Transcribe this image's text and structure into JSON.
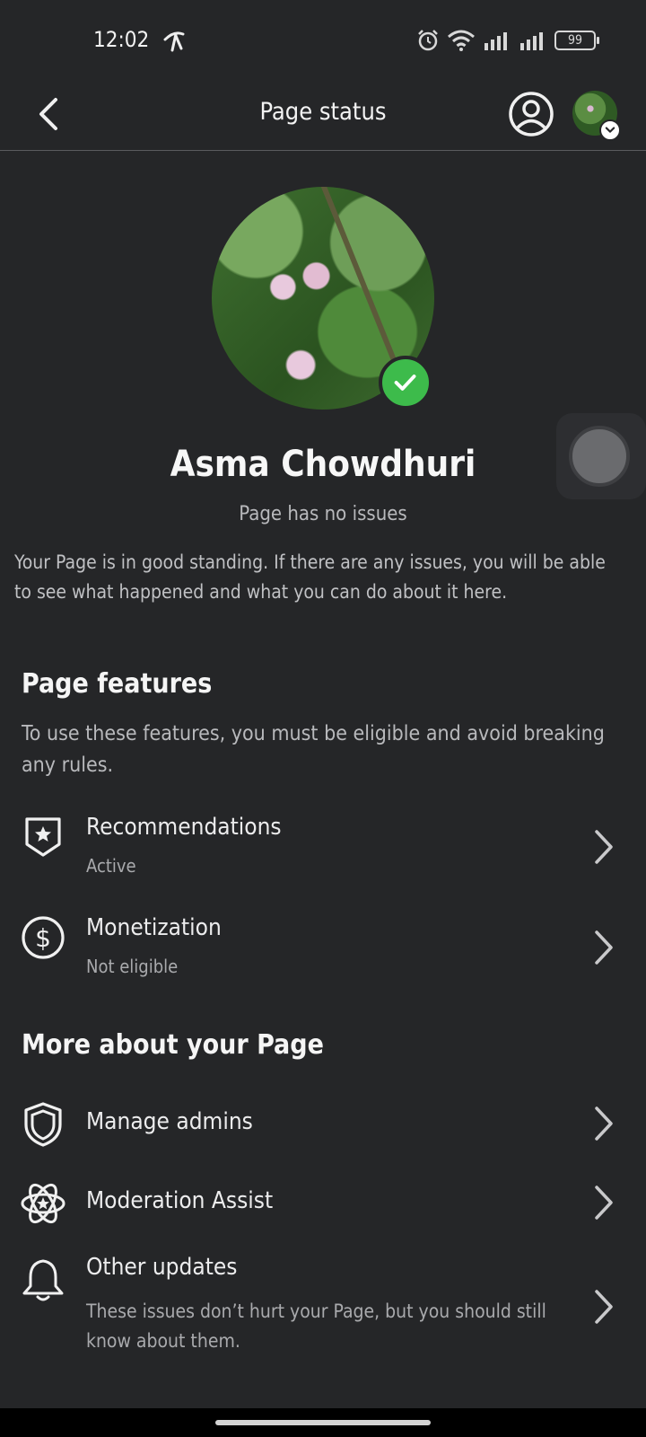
{
  "status_bar": {
    "time": "12:02",
    "battery": "99"
  },
  "app_bar": {
    "title": "Page status"
  },
  "profile": {
    "name": "Asma Chowdhuri",
    "status": "Page has no issues",
    "standing_text": "Your Page is in good standing. If there are any issues, you will be able to see what happened and what you can do about it here."
  },
  "features": {
    "title": "Page features",
    "description": "To use these features, you must be eligible and avoid breaking any rules.",
    "items": [
      {
        "label": "Recommendations",
        "status": "Active",
        "icon": "shield-star-icon"
      },
      {
        "label": "Monetization",
        "status": "Not eligible",
        "icon": "dollar-circle-icon"
      }
    ]
  },
  "more": {
    "title": "More about your Page",
    "items": [
      {
        "label": "Manage admins",
        "icon": "shield-icon"
      },
      {
        "label": "Moderation Assist",
        "icon": "atom-star-icon"
      },
      {
        "label": "Other updates",
        "description": "These issues don’t hurt your Page, but you should still know about them.",
        "icon": "bell-icon"
      }
    ]
  },
  "colors": {
    "background": "#252628",
    "verified_green": "#3dbb4b",
    "text_primary": "#f5f5f5",
    "text_secondary": "#b8b9bc"
  }
}
